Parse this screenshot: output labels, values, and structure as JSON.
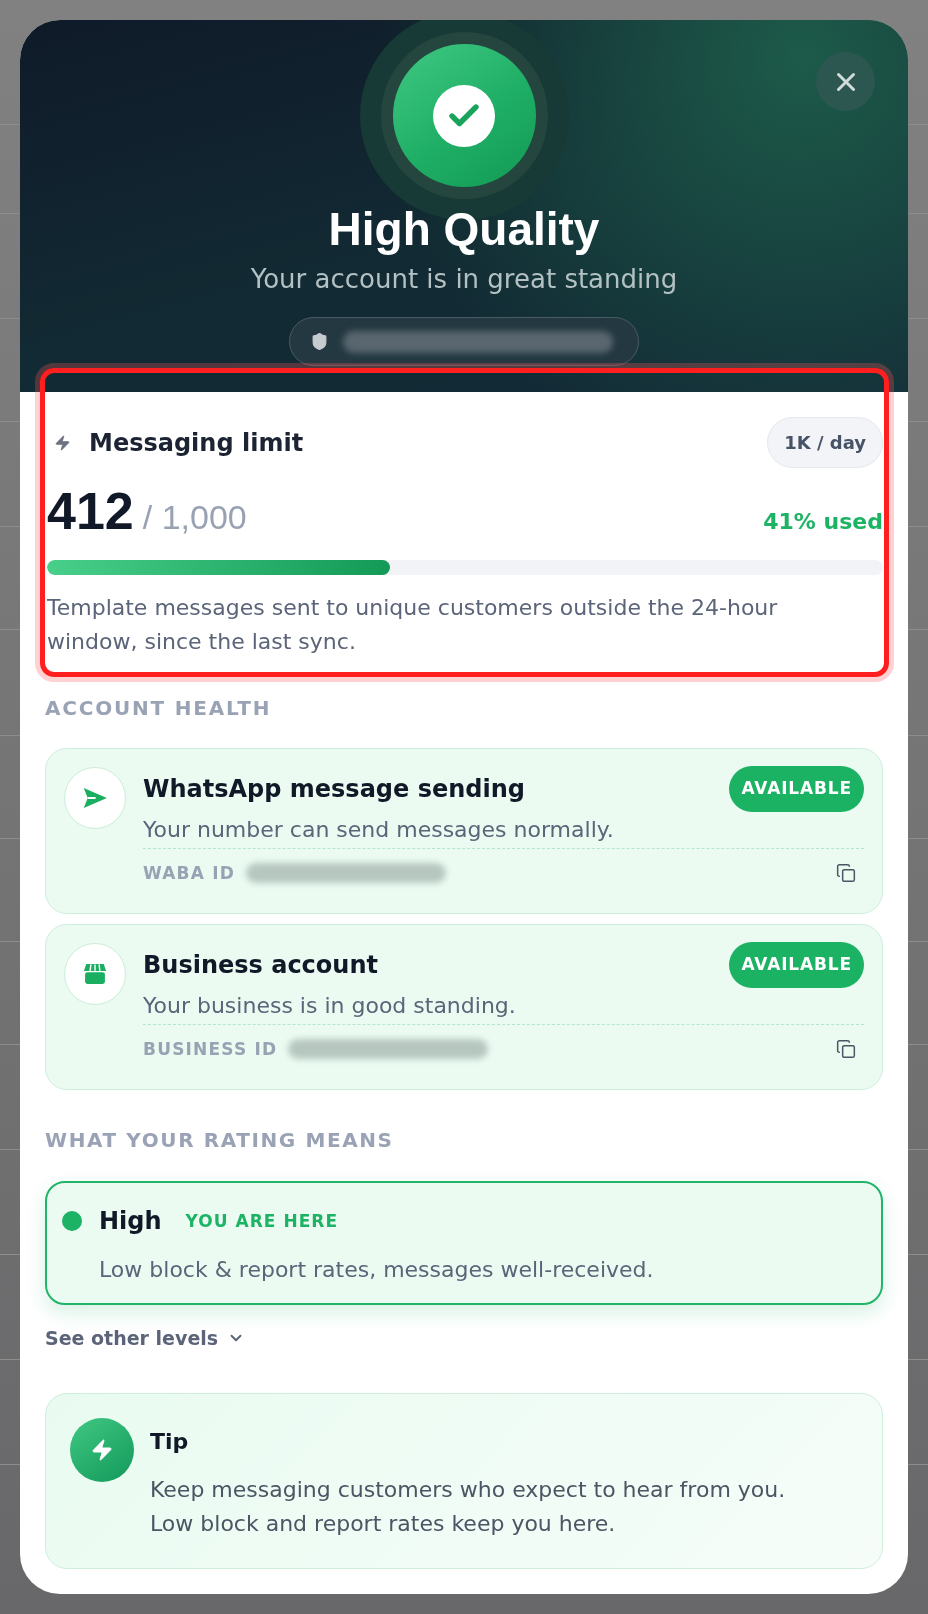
{
  "header": {
    "title": "High Quality",
    "subtitle": "Your account is in great standing"
  },
  "messaging_limit": {
    "highlighted": true,
    "title": "Messaging limit",
    "badge": "1K / day",
    "used": "412",
    "total": "/ 1,000",
    "percent": "41% used",
    "level": 0.41,
    "description": "Template messages sent to unique customers outside the 24-hour window, since the last sync."
  },
  "account_health": {
    "heading": "ACCOUNT HEALTH",
    "items": [
      {
        "kind": "messaging",
        "title": "WhatsApp message sending",
        "description": "Your number can send messages normally.",
        "status": "AVAILABLE",
        "id_label": "WABA ID"
      },
      {
        "kind": "business",
        "title": "Business account",
        "description": "Your business is in good standing.",
        "status": "AVAILABLE",
        "id_label": "BUSINESS ID"
      }
    ]
  },
  "rating": {
    "heading": "WHAT YOUR RATING MEANS",
    "levels": [
      {
        "name": "High",
        "tag": "YOU ARE HERE",
        "description": "Low block & report rates, messages well-received.",
        "selected": true,
        "color": "#1db364"
      }
    ],
    "toggle": {
      "label": "See other levels",
      "expanded": false
    }
  },
  "tip": {
    "title": "Tip",
    "text": "Keep messaging customers who expect to hear from you. Low block and report rates keep you here."
  }
}
